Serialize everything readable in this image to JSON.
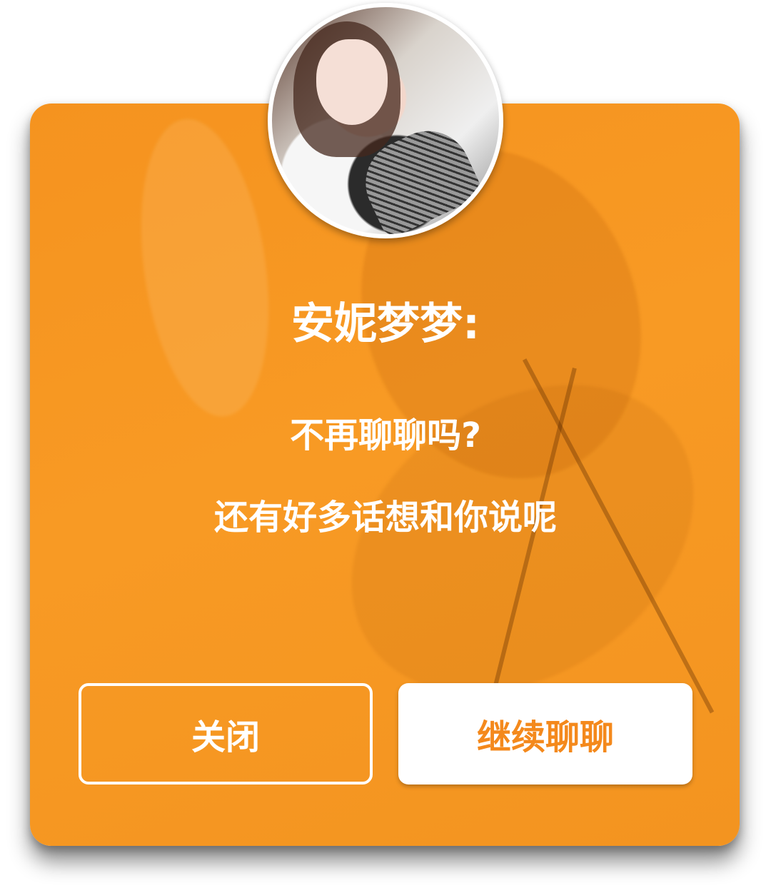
{
  "dialog": {
    "sender_name": "安妮梦梦:",
    "message_line1": "不再聊聊吗?",
    "message_line2": "还有好多话想和你说呢",
    "close_label": "关闭",
    "continue_label": "继续聊聊"
  },
  "colors": {
    "card_bg": "#f89a24",
    "continue_text": "#f4891c",
    "text": "#ffffff"
  }
}
